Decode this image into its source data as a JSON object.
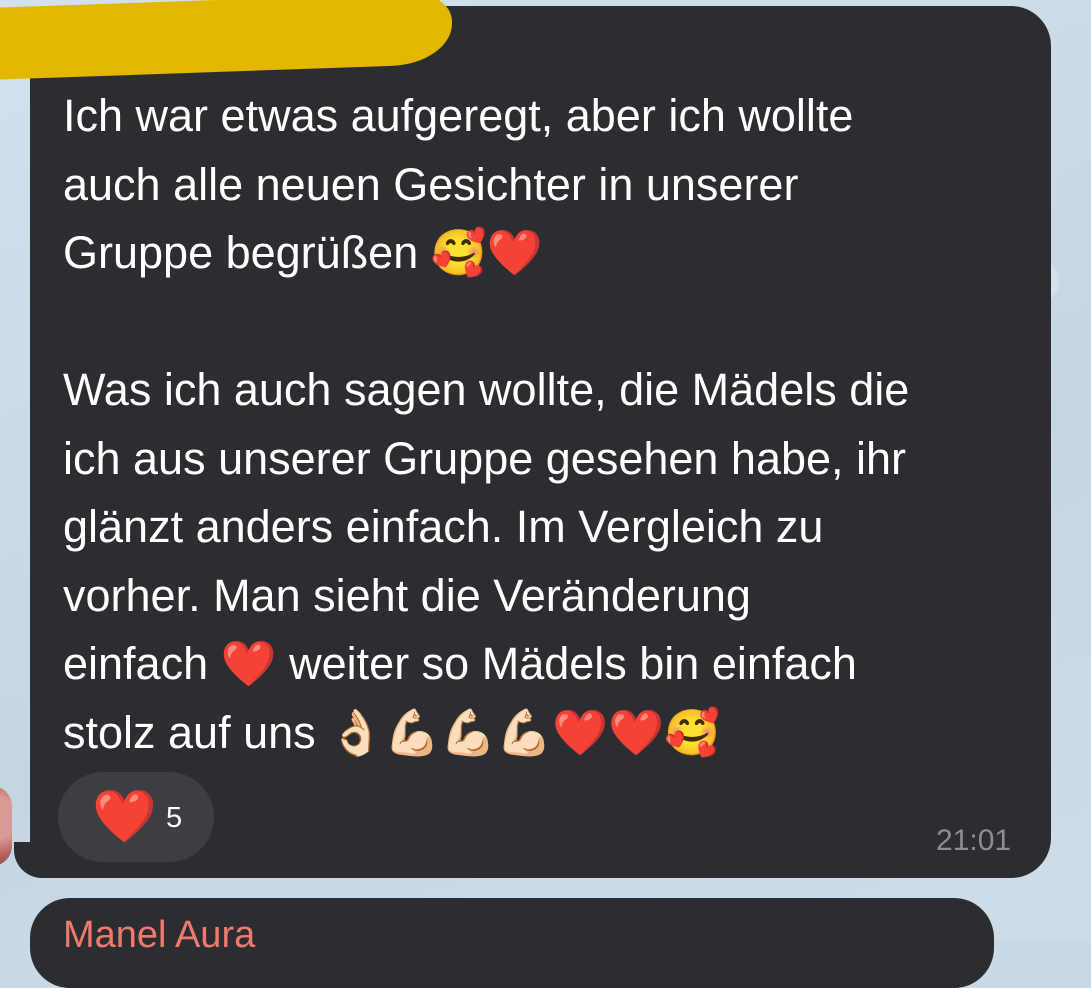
{
  "message": {
    "paragraph1": [
      "Ich war etwas aufgeregt, aber ich wollte",
      "auch alle neuen Gesichter in unserer",
      "Gruppe begrüßen 🥰❤️"
    ],
    "paragraph2": [
      "Was ich auch sagen wollte, die Mädels die",
      "ich aus unserer Gruppe gesehen habe, ihr",
      "glänzt anders einfach. Im Vergleich zu",
      "vorher. Man sieht die Veränderung",
      "einfach ❤️ weiter so Mädels bin einfach",
      "stolz auf uns 👌🏻💪🏻💪🏻💪🏻❤️❤️🥰"
    ],
    "time": "21:01"
  },
  "reaction": {
    "icon": "heart-icon",
    "emoji": "❤️",
    "count": "5"
  },
  "next_message": {
    "sender": "Manel Aura"
  },
  "colors": {
    "bubble": "#2c2d30",
    "reaction_pill": "#3d3e42",
    "text": "#ffffff",
    "timestamp": "#8b8d92",
    "sender_name": "#ee7a6e",
    "redaction": "#e4b800",
    "wallpaper": "#c9d9e6"
  }
}
